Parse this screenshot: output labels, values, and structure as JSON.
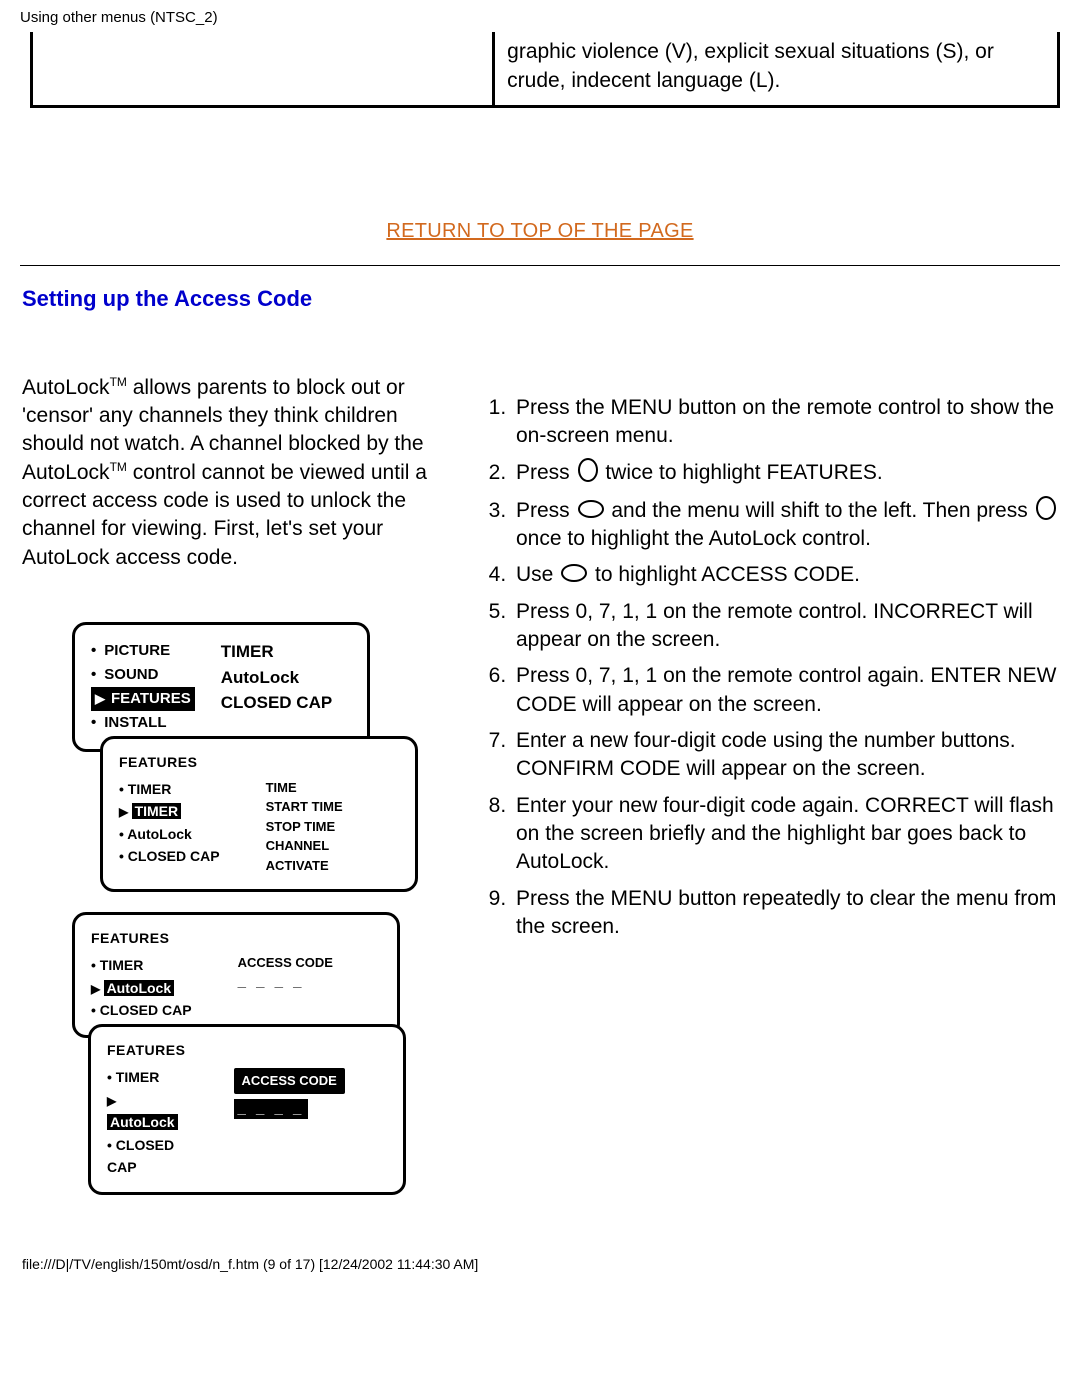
{
  "header": "Using other menus (NTSC_2)",
  "top_cell_right": "graphic violence (V), explicit sexual situations (S), or crude, indecent language (L).",
  "return_link": "RETURN TO TOP OF THE PAGE",
  "section_heading": "Setting up the Access Code",
  "intro_part1": "AutoLock",
  "intro_tm1": "TM",
  "intro_part2": " allows parents to block out or 'censor' any channels they think children should not watch. A channel blocked by the AutoLock",
  "intro_tm2": "TM",
  "intro_part3": " control cannot be viewed until a correct access code is used to unlock the channel for viewing. First, let's set your AutoLock access code.",
  "steps": [
    "Press the MENU button on the remote control to show the on-screen menu.",
    "Press ⬭v twice to highlight FEATURES.",
    "Press ⬭h and the menu will shift to the left. Then press ⬭v once to highlight the AutoLock control.",
    "Use ⬭h to highlight ACCESS CODE.",
    "Press 0, 7, 1, 1 on the remote control. INCORRECT will appear on the screen.",
    "Press 0, 7, 1, 1 on the remote control again. ENTER NEW CODE will appear on the screen.",
    "Enter a new four-digit code using the number buttons. CONFIRM CODE will appear on the screen.",
    "Enter your new four-digit code again. CORRECT will flash on the screen briefly and the highlight bar goes back to AutoLock.",
    "Press the MENU button repeatedly to clear the menu from the screen."
  ],
  "osd": {
    "panel1_left": [
      "PICTURE",
      "SOUND",
      "FEATURES",
      "INSTALL"
    ],
    "panel1_sel": "FEATURES",
    "panel1_right": [
      "TIMER",
      "AutoLock",
      "CLOSED CAP"
    ],
    "panel2_title": "FEATURES",
    "panel2_left": [
      "TIMER",
      "TIMER",
      "AutoLock",
      "CLOSED CAP"
    ],
    "panel2_sel": "TIMER",
    "panel2_right": [
      "TIME",
      "START TIME",
      "STOP TIME",
      "CHANNEL",
      "ACTIVATE"
    ],
    "panel3_title": "FEATURES",
    "panel3_left": [
      "TIMER",
      "AutoLock",
      "CLOSED CAP"
    ],
    "panel3_sel": "AutoLock",
    "panel3_right_label": "ACCESS CODE",
    "panel3_dashes": "_ _ _ _",
    "panel4_title": "FEATURES",
    "panel4_left": [
      "TIMER",
      "AutoLock",
      "CLOSED CAP"
    ],
    "panel4_sel": "AutoLock",
    "panel4_box": "ACCESS CODE",
    "panel4_dashes": "_ _ _ _"
  },
  "footer": "file:///D|/TV/english/150mt/osd/n_f.htm (9 of 17) [12/24/2002 11:44:30 AM]"
}
